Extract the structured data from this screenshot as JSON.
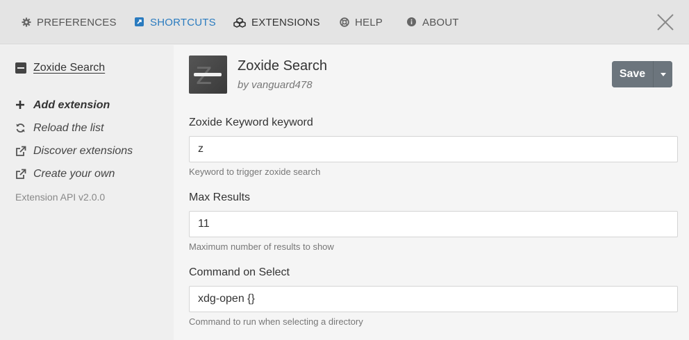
{
  "nav": {
    "preferences": "PREFERENCES",
    "shortcuts": "SHORTCUTS",
    "extensions": "EXTENSIONS",
    "help": "HELP",
    "about": "ABOUT"
  },
  "colors": {
    "accent": "#2a7bbf",
    "save_button": "#6c757d"
  },
  "sidebar": {
    "extension_name": "Zoxide Search",
    "actions": {
      "add": "Add extension",
      "reload": "Reload the list",
      "discover": "Discover extensions",
      "create": "Create your own"
    },
    "api_version": "Extension API v2.0.0"
  },
  "extension": {
    "title": "Zoxide Search",
    "author": "by vanguard478",
    "save_label": "Save"
  },
  "fields": [
    {
      "label": "Zoxide Keyword keyword",
      "value": "z",
      "help": "Keyword to trigger zoxide search"
    },
    {
      "label": "Max Results",
      "value": "11",
      "help": "Maximum number of results to show"
    },
    {
      "label": "Command on Select",
      "value": "xdg-open {}",
      "help": "Command to run when selecting a directory"
    }
  ]
}
